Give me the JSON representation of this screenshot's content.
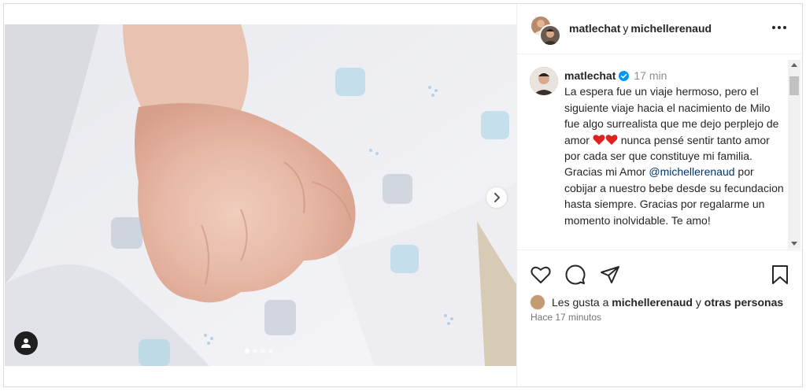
{
  "post": {
    "carousel": {
      "slide_count": 4,
      "active_index": 0
    },
    "header": {
      "user1": "matlechat",
      "connector": "y",
      "user2": "michellerenaud"
    },
    "caption": {
      "username": "matlechat",
      "time": "17 min",
      "text_before_hearts": "La espera fue un viaje hermoso, pero el siguiente viaje hacia el nacimiento de Milo fue algo surrealista que me dejo perplejo de amor",
      "text_after_hearts": "nunca pensé sentir tanto amor por cada ser que constituye mi familia. Gracias mi Amor",
      "mention": "@michellerenaud",
      "text_after_mention": "por cobijar a nuestro bebe desde su fecundacion hasta siempre. Gracias por regalarme un momento inolvidable. Te amo!"
    },
    "likes": {
      "prefix": "Les gusta a",
      "user": "michellerenaud",
      "connector": "y",
      "others": "otras personas"
    },
    "timestamp": "Hace 17 minutos"
  },
  "icons": {
    "heart_emoji_color": "#e0211f",
    "verified_color": "#0095f6"
  }
}
